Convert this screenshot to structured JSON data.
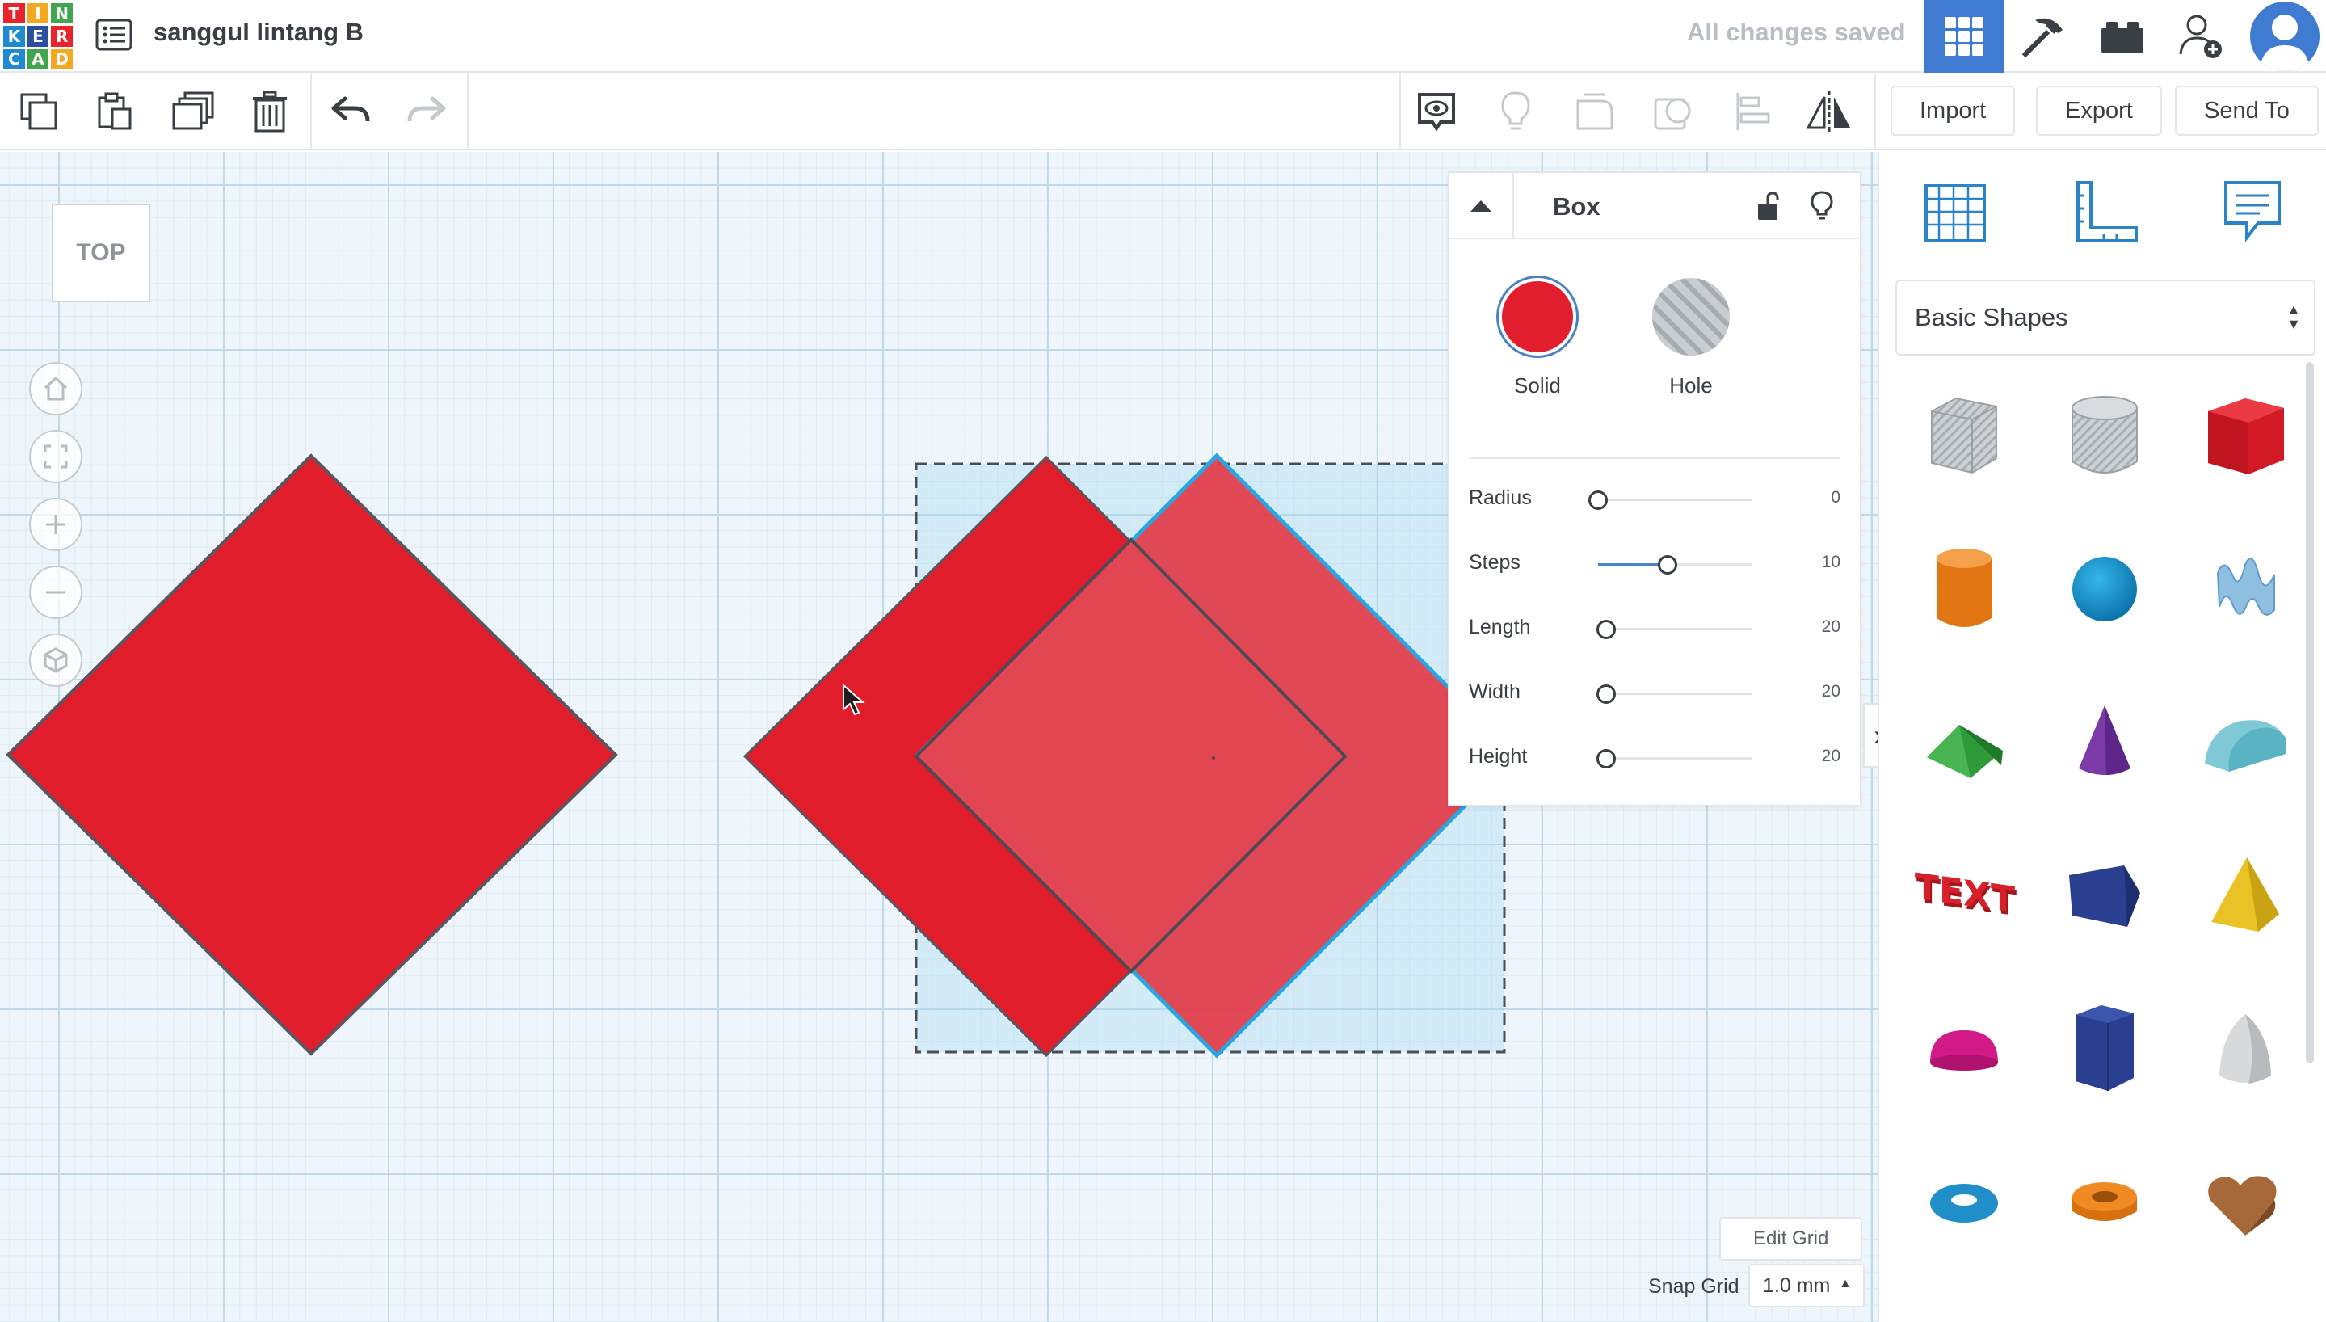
{
  "app": {
    "logo_letters": [
      "T",
      "I",
      "N",
      "K",
      "E",
      "R",
      "C",
      "A",
      "D"
    ],
    "design_title": "sanggul lintang B",
    "save_status": "All changes saved",
    "views": [
      "grid-3d-view-icon",
      "pickaxe-build-icon",
      "bricks-icon"
    ]
  },
  "toolbar": {
    "import_label": "Import",
    "export_label": "Export",
    "send_to_label": "Send To"
  },
  "workplane": {
    "viewcube_label": "TOP",
    "edit_grid_label": "Edit Grid",
    "snap_grid_label": "Snap Grid",
    "snap_grid_value": "1.0 mm"
  },
  "inspector": {
    "title": "Box",
    "solid_label": "Solid",
    "hole_label": "Hole",
    "props": [
      {
        "label": "Radius",
        "value": "0",
        "pos": 0.0
      },
      {
        "label": "Steps",
        "value": "10",
        "pos": 0.45
      },
      {
        "label": "Length",
        "value": "20",
        "pos": 0.05
      },
      {
        "label": "Width",
        "value": "20",
        "pos": 0.05
      },
      {
        "label": "Height",
        "value": "20",
        "pos": 0.05
      }
    ]
  },
  "library": {
    "selected": "Basic Shapes",
    "shapes": [
      "box-hole-shape",
      "cylinder-hole-shape",
      "box-shape",
      "cylinder-shape",
      "sphere-shape",
      "scribble-shape",
      "roof-shape",
      "cone-shape",
      "round-roof-shape",
      "text-shape",
      "polygon-shape",
      "pyramid-shape",
      "half-sphere-shape",
      "hexagonal-prism-shape",
      "paraboloid-shape",
      "torus-shape",
      "tube-shape",
      "heart-shape"
    ]
  },
  "colors": {
    "accent": "#3e7bd1",
    "solid_red": "#e21d2e",
    "selection_blue": "#2aa6e0"
  }
}
